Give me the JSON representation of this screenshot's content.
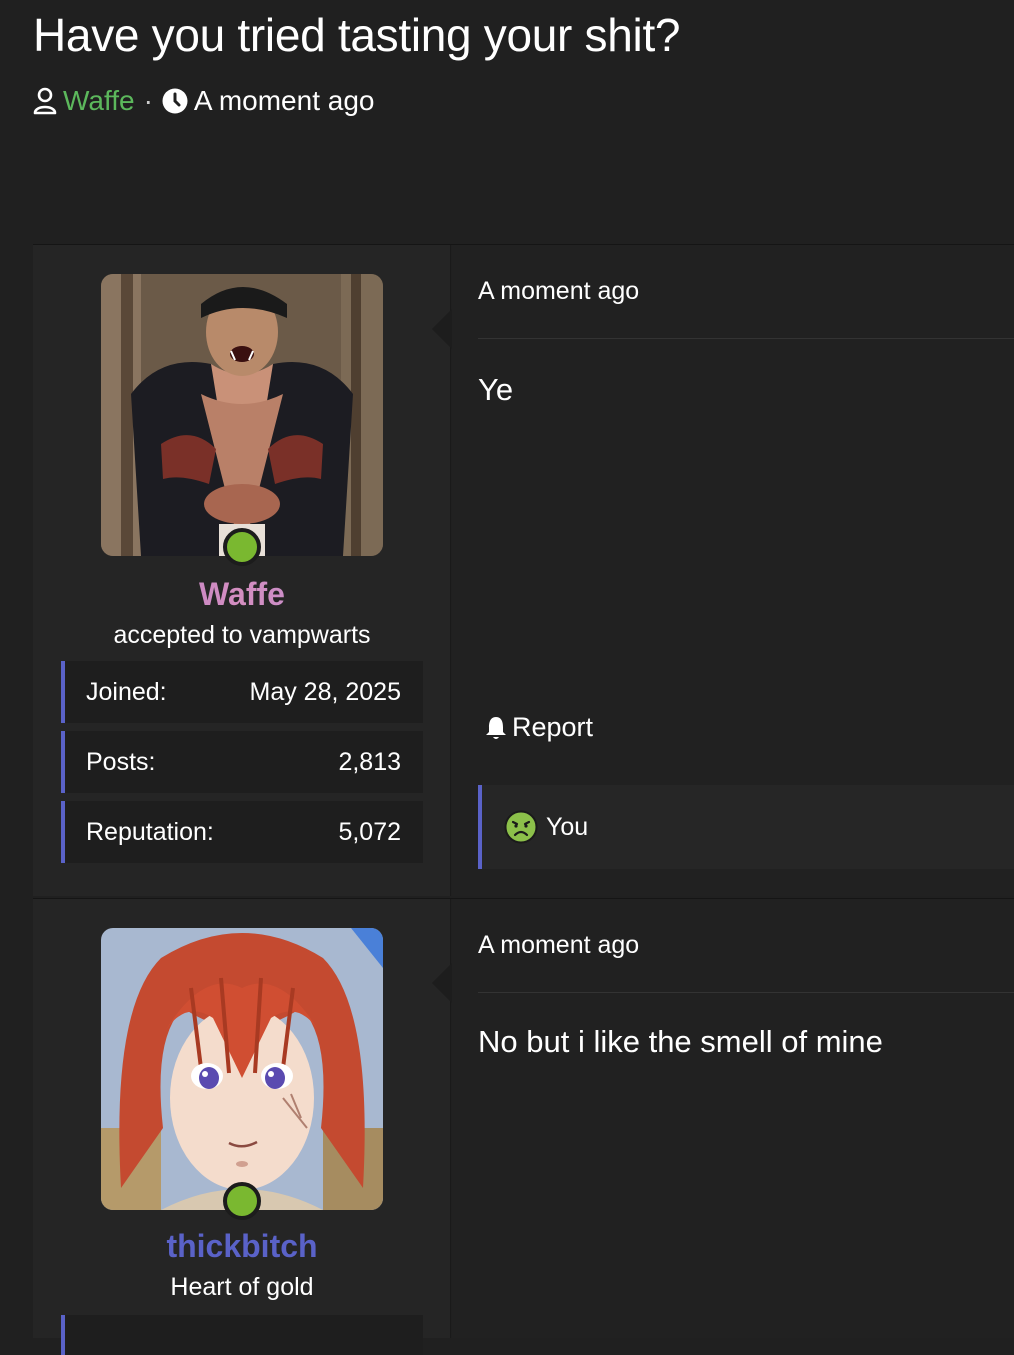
{
  "thread": {
    "title": "Have you tried tasting your shit?",
    "author": "Waffe",
    "separator": "·",
    "time": "A moment ago",
    "author_color": "#5cb85c"
  },
  "posts": [
    {
      "author": {
        "username": "Waffe",
        "usertitle": "accepted to vampwarts",
        "online": true,
        "avatar_icon": "werewolf-avatar",
        "stats": [
          {
            "label": "Joined:",
            "value": "May 28, 2025"
          },
          {
            "label": "Posts:",
            "value": "2,813"
          },
          {
            "label": "Reputation:",
            "value": "5,072"
          }
        ]
      },
      "time": "A moment ago",
      "body": "Ye",
      "report_label": "Report",
      "reaction": {
        "icon": "nauseated-face-icon",
        "label": "You"
      }
    },
    {
      "author": {
        "username": "thickbitch",
        "usertitle": "Heart of gold",
        "online": true,
        "avatar_icon": "anime-redhead-avatar",
        "username_color": "#5a62c8"
      },
      "time": "A moment ago",
      "body": "No but i like the smell of mine"
    }
  ],
  "colors": {
    "background": "#202020",
    "accent": "#5a62c8",
    "online": "#7ab830"
  }
}
